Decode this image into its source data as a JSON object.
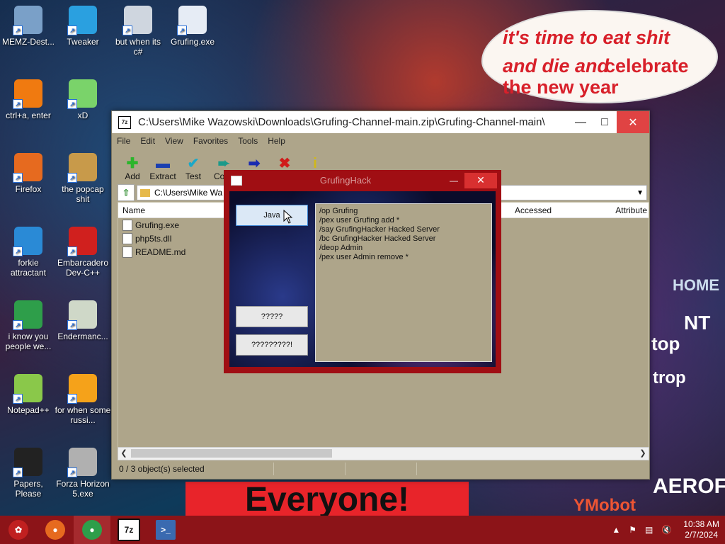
{
  "desktop": {
    "icons": [
      {
        "label": "MEMZ-Dest...",
        "icon": "recycle-bin-icon",
        "color": "#7aa0c8"
      },
      {
        "label": "Tweaker",
        "icon": "gear-icon",
        "color": "#2aa0e0"
      },
      {
        "label": "but when its c#",
        "icon": "windows-stack-icon",
        "color": "#cfd6df"
      },
      {
        "label": "Grufing.exe",
        "icon": "console-app-icon",
        "color": "#e6ecf5"
      },
      {
        "label": "ctrl+a, enter",
        "icon": "ring-icon",
        "color": "#f07a10"
      },
      {
        "label": "xD",
        "icon": "hxd-icon",
        "color": "#7ad36a"
      },
      {
        "label": "Firefox",
        "icon": "firefox-icon",
        "color": "#e66a1f"
      },
      {
        "label": "the popcap shit",
        "icon": "popcap-icon",
        "color": "#c89a4a"
      },
      {
        "label": "forkie attractant",
        "icon": "monitor-gear-icon",
        "color": "#2a8ad6"
      },
      {
        "label": "Embarcadero Dev-C++",
        "icon": "devcpp-icon",
        "color": "#d0201e"
      },
      {
        "label": "i know you people we...",
        "icon": "chrome-icon",
        "color": "#2e9e4a"
      },
      {
        "label": "Endermanc...",
        "icon": "window-app-icon",
        "color": "#cfd8c8"
      },
      {
        "label": "Notepad++",
        "icon": "notepadpp-icon",
        "color": "#8ac84a"
      },
      {
        "label": "for when some russi...",
        "icon": "de-icon",
        "color": "#f5a21a"
      },
      {
        "label": "Papers, Please",
        "icon": "papers-please-icon",
        "color": "#222222"
      },
      {
        "label": "Forza Horizon 5.exe",
        "icon": "flash-icon",
        "color": "#b0b0b0"
      }
    ],
    "bubble_lines": [
      "it's time to eat shit",
      "and die and",
      "celebrate",
      "the new year"
    ],
    "banner": "Everyone!",
    "sign_home": "HOME",
    "sign_nt": "NT",
    "sign_top": "top",
    "sign_trop": "trop",
    "sign_aerofos": "AEROFOS",
    "sign_ymobot": "YMobot"
  },
  "window_7zip": {
    "title": "C:\\Users\\Mike Wazowski\\Downloads\\Grufing-Channel-main.zip\\Grufing-Channel-main\\",
    "app_icon": "7z",
    "menu": [
      "File",
      "Edit",
      "View",
      "Favorites",
      "Tools",
      "Help"
    ],
    "toolbar": [
      {
        "label": "Add",
        "icon": "plus-icon",
        "glyph": "✚",
        "color": "#2bb52b"
      },
      {
        "label": "Extract",
        "icon": "minus-icon",
        "glyph": "▬",
        "color": "#1a3fb0"
      },
      {
        "label": "Test",
        "icon": "check-icon",
        "glyph": "✔",
        "color": "#1aa8c8"
      },
      {
        "label": "Copy",
        "icon": "copy-arrow-icon",
        "glyph": "➨",
        "color": "#1a9a8a"
      },
      {
        "label": "Move",
        "icon": "move-arrow-icon",
        "glyph": "➡",
        "color": "#1a2ab0"
      },
      {
        "label": "Delete",
        "icon": "delete-x-icon",
        "glyph": "✖",
        "color": "#d01a1a"
      },
      {
        "label": "Info",
        "icon": "info-icon",
        "glyph": "i",
        "color": "#d0b81a"
      }
    ],
    "path": "C:\\Users\\Mike Wa",
    "columns": {
      "name": "Name",
      "accessed": "Accessed",
      "attributes": "Attribute"
    },
    "files": [
      "Grufing.exe",
      "php5ts.dll",
      "README.md"
    ],
    "status": "0 / 3 object(s) selected"
  },
  "window_gruf": {
    "title": "GrufingHack",
    "buttons": {
      "java": "Java",
      "q1": "?????",
      "q2": "?????????!"
    },
    "commands": [
      "/op Grufing",
      "/pex user Grufing add *",
      "/say GrufingHacker Hacked Server",
      "/bc GrufingHacker Hacked Server",
      "/deop Admin",
      "/pex user Admin remove *"
    ]
  },
  "taskbar": {
    "items": [
      {
        "name": "start-orb-icon",
        "text": "✿",
        "color": "#c02020"
      },
      {
        "name": "firefox-icon",
        "text": "●",
        "color": "#e66a1f"
      },
      {
        "name": "chrome-icon",
        "text": "●",
        "color": "#2e9e4a"
      },
      {
        "name": "7zip-icon",
        "text": "7z",
        "color": "#111111"
      },
      {
        "name": "console-app-icon",
        "text": ">_",
        "color": "#3a6ab0"
      }
    ],
    "time": "10:38 AM",
    "date": "2/7/2024"
  }
}
